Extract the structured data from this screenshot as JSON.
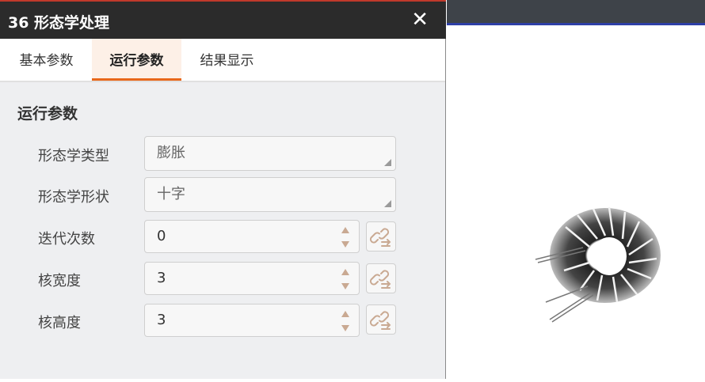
{
  "window": {
    "title": "36 形态学处理",
    "close_icon": "close-icon"
  },
  "tabs": [
    {
      "label": "基本参数",
      "active": false
    },
    {
      "label": "运行参数",
      "active": true
    },
    {
      "label": "结果显示",
      "active": false
    }
  ],
  "section": {
    "title": "运行参数"
  },
  "params": {
    "morph_type": {
      "label": "形态学类型",
      "value": "膨胀"
    },
    "morph_shape": {
      "label": "形态学形状",
      "value": "十字"
    },
    "iterations": {
      "label": "迭代次数",
      "value": "0"
    },
    "kernel_width": {
      "label": "核宽度",
      "value": "3"
    },
    "kernel_height": {
      "label": "核高度",
      "value": "3"
    }
  },
  "colors": {
    "accent": "#e8671a",
    "titlebar": "#2b2b2b",
    "panel_bg": "#eeeff1"
  }
}
